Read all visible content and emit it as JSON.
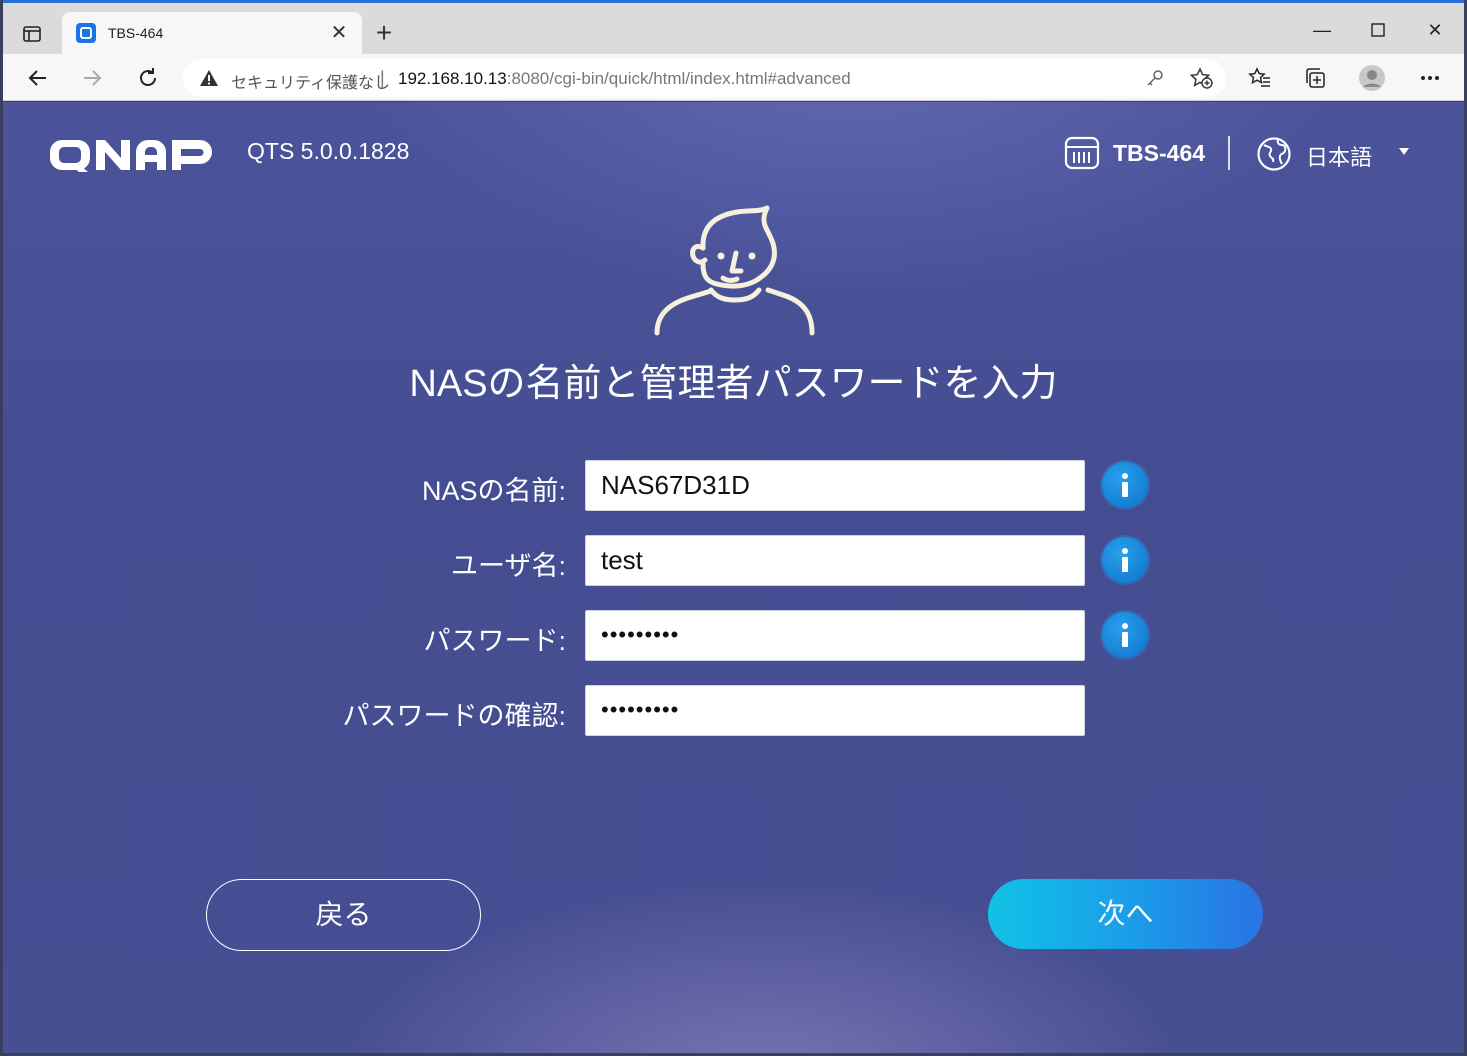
{
  "browser": {
    "tab_title": "TBS-464",
    "security_label": "セキュリティ保護なし",
    "url_host": "192.168.10.13",
    "url_path": ":8080/cgi-bin/quick/html/index.html#advanced"
  },
  "header": {
    "qts_version": "QTS 5.0.0.1828",
    "model": "TBS-464",
    "language": "日本語"
  },
  "main": {
    "heading": "NASの名前と管理者パスワードを入力",
    "fields": [
      {
        "label": "NASの名前:",
        "value": "NAS67D31D"
      },
      {
        "label": "ユーザ名:",
        "value": "test"
      },
      {
        "label": "パスワード:",
        "value": "•••••••••"
      },
      {
        "label": "パスワードの確認:",
        "value": "•••••••••"
      }
    ],
    "back_label": "戻る",
    "next_label": "次へ"
  },
  "colors": {
    "page_bg": "#4a5296",
    "next_gradient_start": "#11c2e6",
    "next_gradient_end": "#2a73e4",
    "info_blue": "#0b72c9",
    "accent_tab": "#2a6fd6"
  }
}
